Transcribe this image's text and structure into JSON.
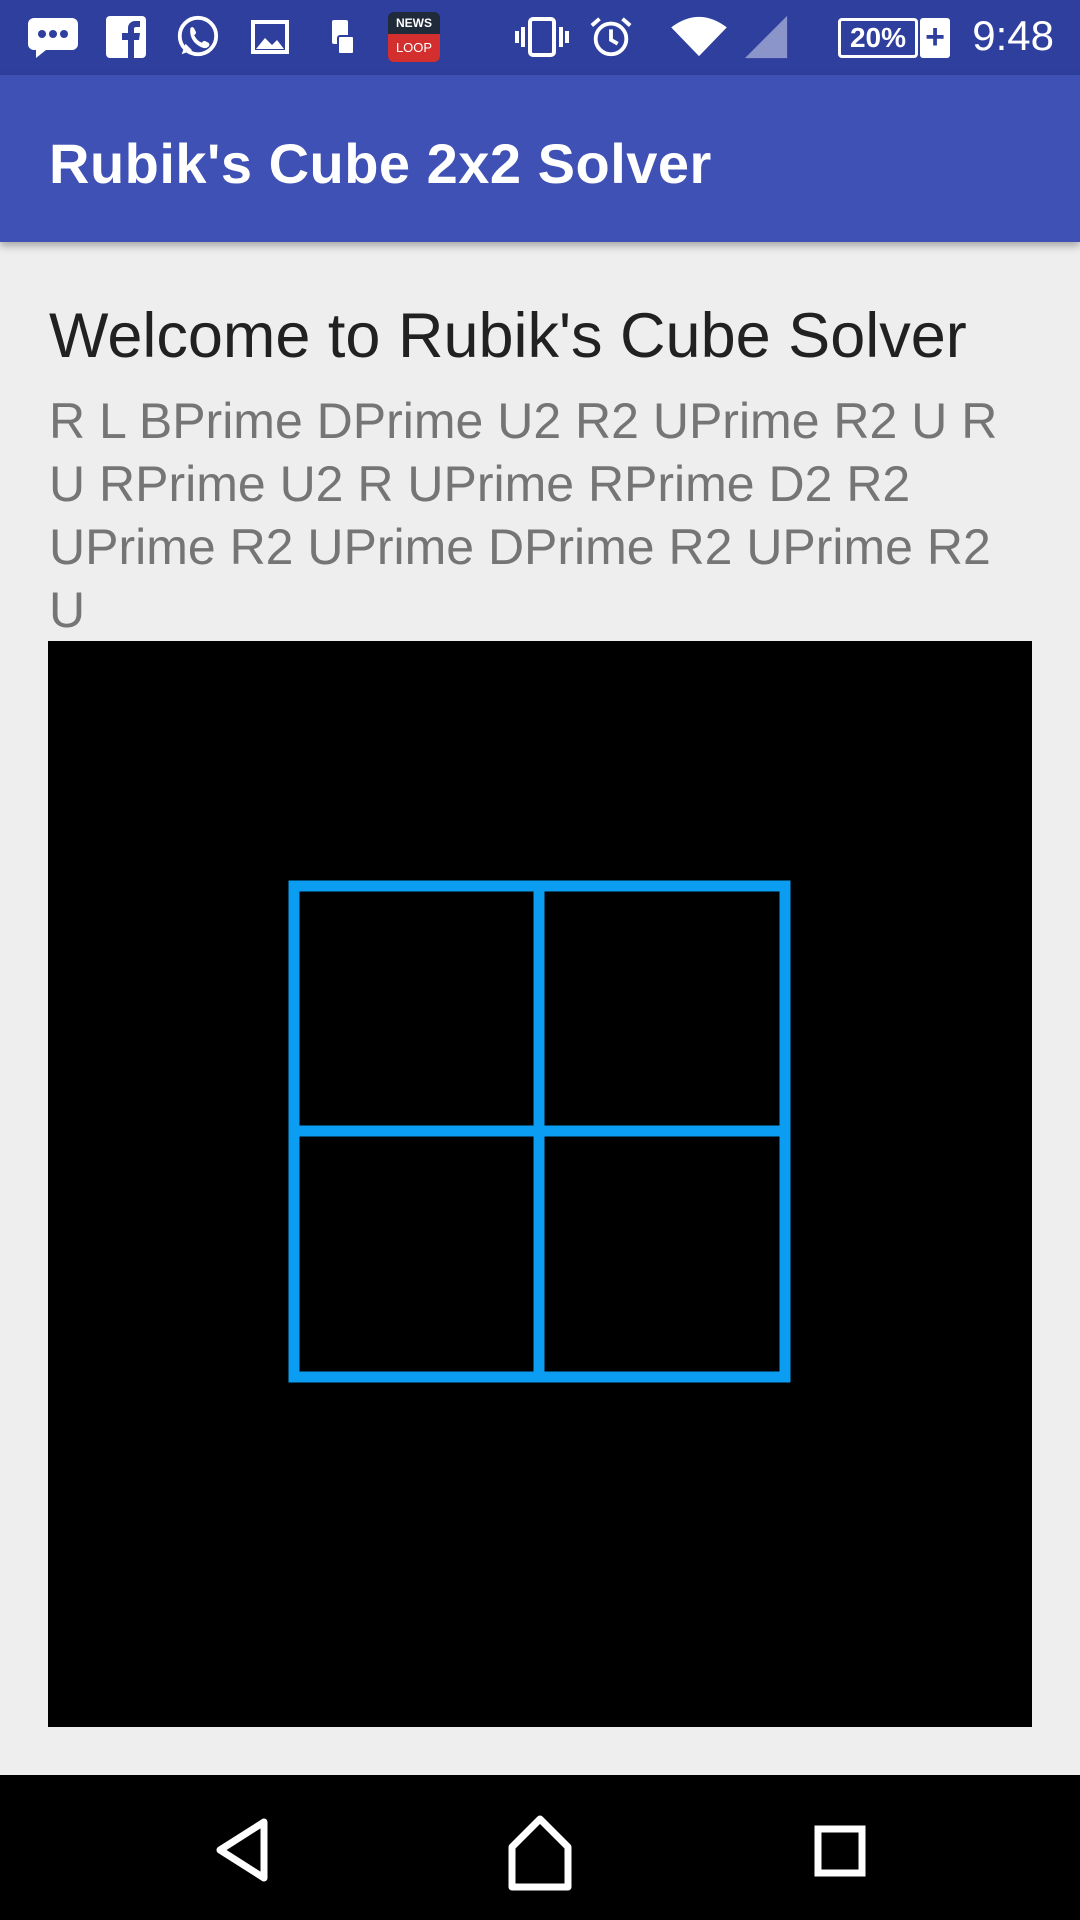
{
  "status_bar": {
    "time": "9:48",
    "battery_percent": "20%",
    "battery_charging_symbol": "+",
    "news_badge_top": "NEWS",
    "news_badge_bottom": "LOOP",
    "icons": [
      "messenger-icon",
      "facebook-icon",
      "whatsapp-icon",
      "gallery-icon",
      "phone-storage-icon",
      "news-loop-icon",
      "vibrate-icon",
      "alarm-icon",
      "wifi-icon",
      "signal-icon",
      "battery-icon"
    ],
    "background_color": "#2f3f9e"
  },
  "app_bar": {
    "title": "Rubik's Cube 2x2 Solver",
    "background_color": "#3f51b5"
  },
  "content": {
    "welcome_heading": "Welcome to Rubik's Cube Solver",
    "solution_moves": "R L BPrime DPrime U2 R2 UPrime R2 U R U RPrime U2 R UPrime RPrime D2 R2 UPrime R2 UPrime DPrime R2 UPrime R2 U"
  },
  "cube_view": {
    "grid_color": "#0a9df2",
    "background_color": "#000000",
    "rows": 2,
    "cols": 2
  },
  "nav_bar": {
    "buttons": [
      "back-icon",
      "home-icon",
      "recents-icon"
    ]
  }
}
